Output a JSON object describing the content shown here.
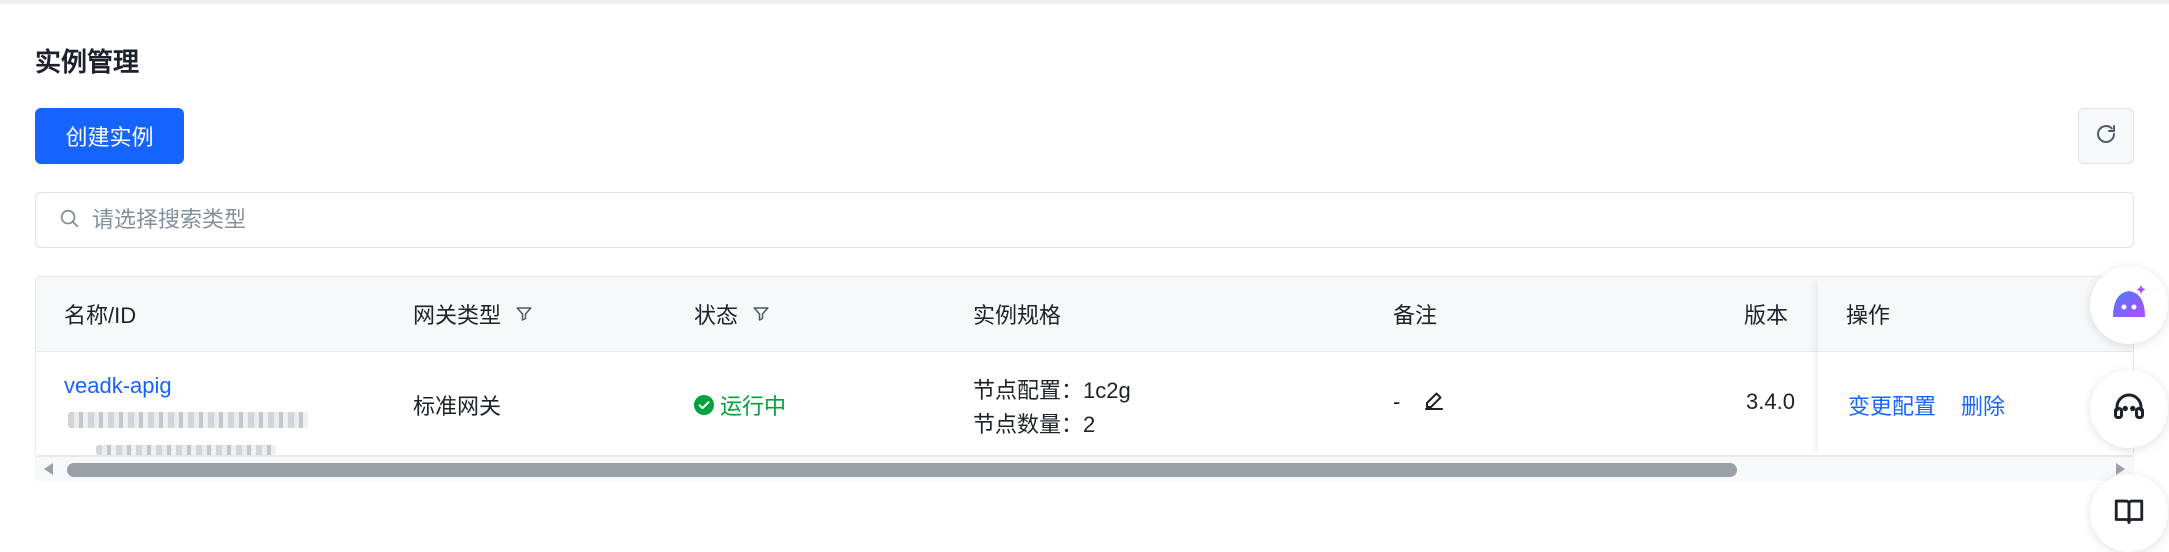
{
  "page": {
    "title": "实例管理"
  },
  "toolbar": {
    "create_label": "创建实例",
    "refresh_icon": "refresh-icon"
  },
  "search": {
    "placeholder": "请选择搜索类型",
    "value": ""
  },
  "table": {
    "columns": [
      "名称/ID",
      "网关类型",
      "状态",
      "实例规格",
      "备注",
      "版本",
      "操作"
    ],
    "filterable_columns": [
      "网关类型",
      "状态"
    ],
    "rows": [
      {
        "name": "veadk-apig",
        "gateway_type": "标准网关",
        "status": "运行中",
        "spec_line1": "节点配置：1c2g",
        "spec_line2": "节点数量：2",
        "remark": "-",
        "version": "3.4.0",
        "actions": [
          "变更配置",
          "删除"
        ]
      }
    ]
  },
  "colors": {
    "primary": "#1664ff",
    "success": "#00a23c",
    "border": "#e5e8ef",
    "header_bg": "#f6f8fa"
  },
  "floating": [
    "ai-assistant-icon",
    "headset-icon",
    "book-icon"
  ]
}
